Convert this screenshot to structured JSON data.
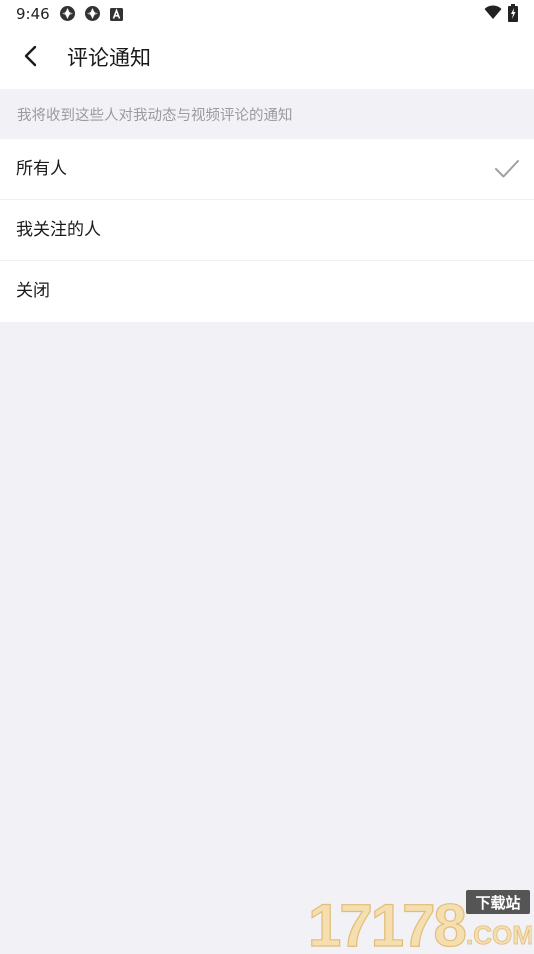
{
  "status_bar": {
    "time": "9:46"
  },
  "header": {
    "title": "评论通知",
    "back_icon": "chevron-left-icon"
  },
  "hint": {
    "text": "我将收到这些人对我动态与视频评论的通知"
  },
  "options": [
    {
      "label": "所有人",
      "selected": true
    },
    {
      "label": "我关注的人",
      "selected": false
    },
    {
      "label": "关闭",
      "selected": false
    }
  ],
  "watermark": {
    "number": "17178",
    "badge": "下载站",
    "suffix": ".COM"
  },
  "colors": {
    "background": "#f1f1f6",
    "surface": "#ffffff",
    "text_primary": "#1a1a1a",
    "text_hint": "#9a9aa0",
    "check": "#a0a0a0"
  }
}
